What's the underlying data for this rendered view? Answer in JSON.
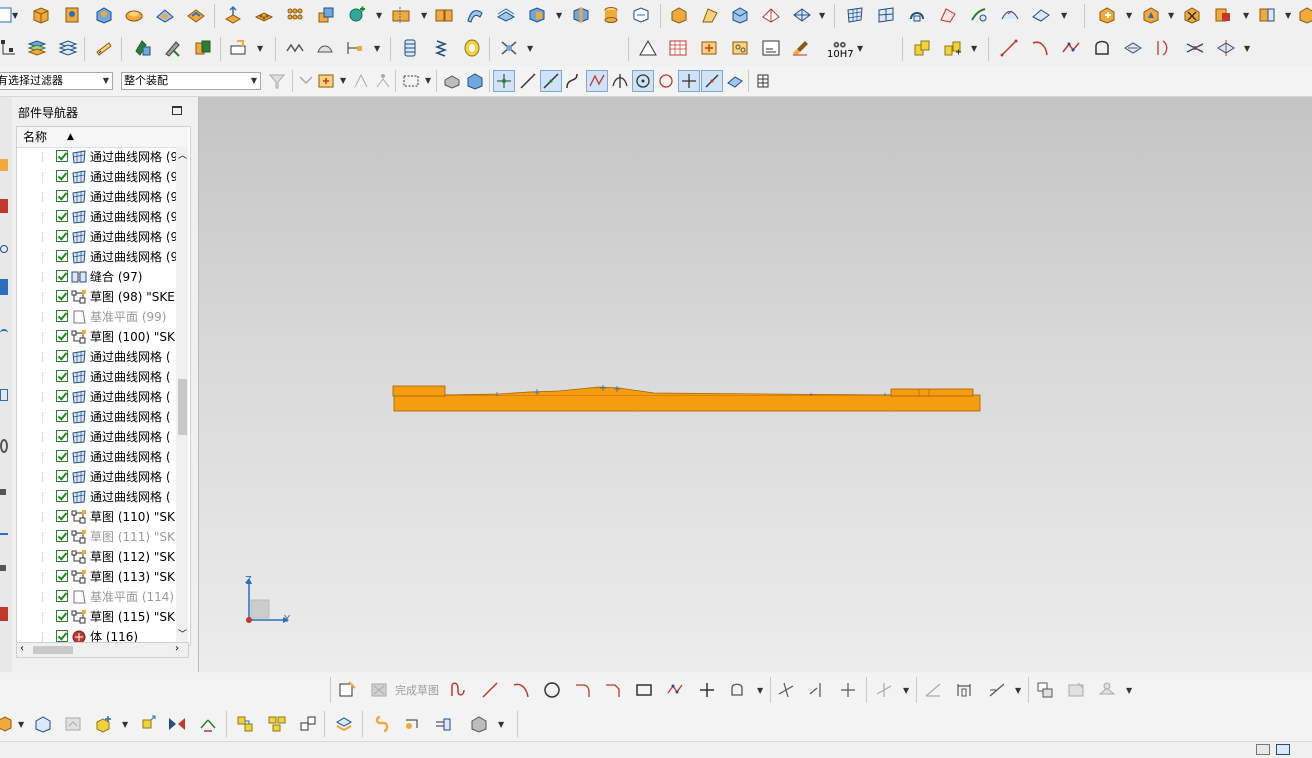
{
  "filters": {
    "selection_filter": "有选择过滤器",
    "assembly_scope": "整个装配"
  },
  "part_navigator": {
    "title": "部件导航器",
    "column_name": "名称",
    "sort_arrow": "▲",
    "items": [
      {
        "label": "通过曲线网格 (9",
        "icon": "mesh-surface-icon",
        "dim": false
      },
      {
        "label": "通过曲线网格 (9",
        "icon": "mesh-surface-icon",
        "dim": false
      },
      {
        "label": "通过曲线网格 (9",
        "icon": "mesh-surface-icon",
        "dim": false
      },
      {
        "label": "通过曲线网格 (9",
        "icon": "mesh-surface-icon",
        "dim": false
      },
      {
        "label": "通过曲线网格 (9",
        "icon": "mesh-surface-icon",
        "dim": false
      },
      {
        "label": "通过曲线网格 (9",
        "icon": "mesh-surface-icon",
        "dim": false
      },
      {
        "label": "缝合 (97)",
        "icon": "sew-icon",
        "dim": false
      },
      {
        "label": "草图 (98) \"SKE",
        "icon": "sketch-icon",
        "dim": false
      },
      {
        "label": "基准平面 (99)",
        "icon": "datum-plane-icon",
        "dim": true
      },
      {
        "label": "草图 (100) \"SK",
        "icon": "sketch-icon",
        "dim": false
      },
      {
        "label": "通过曲线网格 (",
        "icon": "mesh-surface-icon",
        "dim": false
      },
      {
        "label": "通过曲线网格 (",
        "icon": "mesh-surface-icon",
        "dim": false
      },
      {
        "label": "通过曲线网格 (",
        "icon": "mesh-surface-icon",
        "dim": false
      },
      {
        "label": "通过曲线网格 (",
        "icon": "mesh-surface-icon",
        "dim": false
      },
      {
        "label": "通过曲线网格 (",
        "icon": "mesh-surface-icon",
        "dim": false
      },
      {
        "label": "通过曲线网格 (",
        "icon": "mesh-surface-icon",
        "dim": false
      },
      {
        "label": "通过曲线网格 (",
        "icon": "mesh-surface-icon",
        "dim": false
      },
      {
        "label": "通过曲线网格 (",
        "icon": "mesh-surface-icon",
        "dim": false
      },
      {
        "label": "草图 (110) \"SK",
        "icon": "sketch-icon",
        "dim": false
      },
      {
        "label": "草图 (111) \"SK",
        "icon": "sketch-icon",
        "dim": true
      },
      {
        "label": "草图 (112) \"SK",
        "icon": "sketch-icon",
        "dim": false
      },
      {
        "label": "草图 (113) \"SK",
        "icon": "sketch-icon",
        "dim": false
      },
      {
        "label": "基准平面 (114)",
        "icon": "datum-plane-icon",
        "dim": true
      },
      {
        "label": "草图 (115) \"SK",
        "icon": "sketch-icon",
        "dim": false
      },
      {
        "label": "体 (116)",
        "icon": "body-icon",
        "dim": false
      }
    ]
  },
  "sketch_toolbar": {
    "finish_sketch_label": "完成草图",
    "tolerance_label": "10H7"
  },
  "viewport": {
    "axis_z": "Z",
    "axis_y": "Y",
    "model_color": "#f59d0e"
  },
  "colors": {
    "accent_blue": "#2a6ebd",
    "part_orange": "#f59d0e",
    "check_green": "#1a8a1a"
  }
}
